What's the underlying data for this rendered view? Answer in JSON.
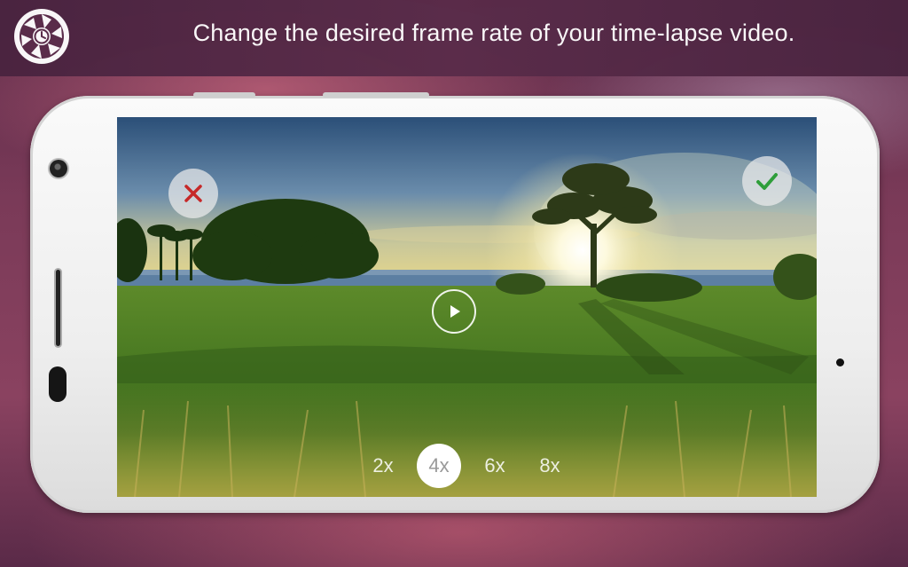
{
  "header": {
    "text": "Change the desired frame rate of your time-lapse video.",
    "logo_icon": "shutter-timer-logo-icon"
  },
  "preview": {
    "cancel_icon": "close-icon",
    "confirm_icon": "checkmark-icon",
    "play_icon": "play-icon"
  },
  "speed_options": [
    {
      "label": "2x",
      "selected": false
    },
    {
      "label": "4x",
      "selected": true
    },
    {
      "label": "6x",
      "selected": false
    },
    {
      "label": "8x",
      "selected": false
    }
  ],
  "colors": {
    "cancel": "#c62828",
    "confirm": "#2e9e3a",
    "header_bg": "#4f2745"
  }
}
